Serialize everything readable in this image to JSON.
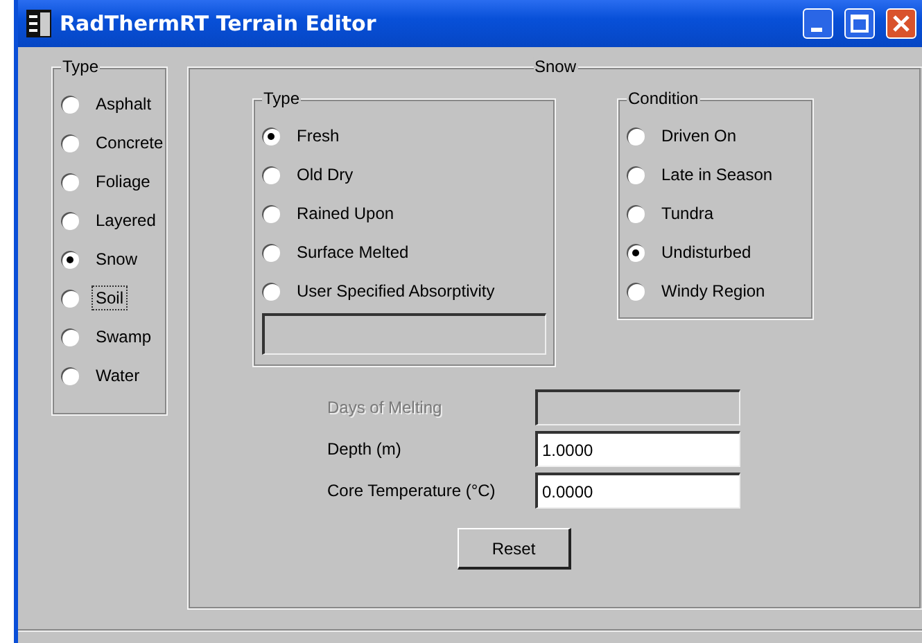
{
  "window": {
    "title": "RadThermRT Terrain Editor"
  },
  "terrain_type": {
    "title": "Type",
    "options": [
      {
        "label": "Asphalt",
        "selected": false,
        "focused": false
      },
      {
        "label": "Concrete",
        "selected": false,
        "focused": false
      },
      {
        "label": "Foliage",
        "selected": false,
        "focused": false
      },
      {
        "label": "Layered",
        "selected": false,
        "focused": false
      },
      {
        "label": "Snow",
        "selected": true,
        "focused": false
      },
      {
        "label": "Soil",
        "selected": false,
        "focused": true
      },
      {
        "label": "Swamp",
        "selected": false,
        "focused": false
      },
      {
        "label": "Water",
        "selected": false,
        "focused": false
      }
    ]
  },
  "snow": {
    "title": "Snow",
    "type": {
      "title": "Type",
      "options": [
        {
          "label": "Fresh",
          "selected": true
        },
        {
          "label": "Old Dry",
          "selected": false
        },
        {
          "label": "Rained Upon",
          "selected": false
        },
        {
          "label": "Surface Melted",
          "selected": false
        },
        {
          "label": "User Specified Absorptivity",
          "selected": false
        }
      ],
      "absorptivity_field": {
        "disabled": true
      }
    },
    "condition": {
      "title": "Condition",
      "options": [
        {
          "label": "Driven On",
          "selected": false
        },
        {
          "label": "Late in Season",
          "selected": false
        },
        {
          "label": "Tundra",
          "selected": false
        },
        {
          "label": "Undisturbed",
          "selected": true
        },
        {
          "label": "Windy Region",
          "selected": false
        }
      ]
    },
    "fields": [
      {
        "label": "Days of Melting",
        "disabled": true
      },
      {
        "label": "Depth (m)",
        "value": "1.0000",
        "disabled": false
      },
      {
        "label": "Core Temperature (°C)",
        "value": "0.0000",
        "disabled": false
      }
    ],
    "reset_button": "Reset"
  }
}
